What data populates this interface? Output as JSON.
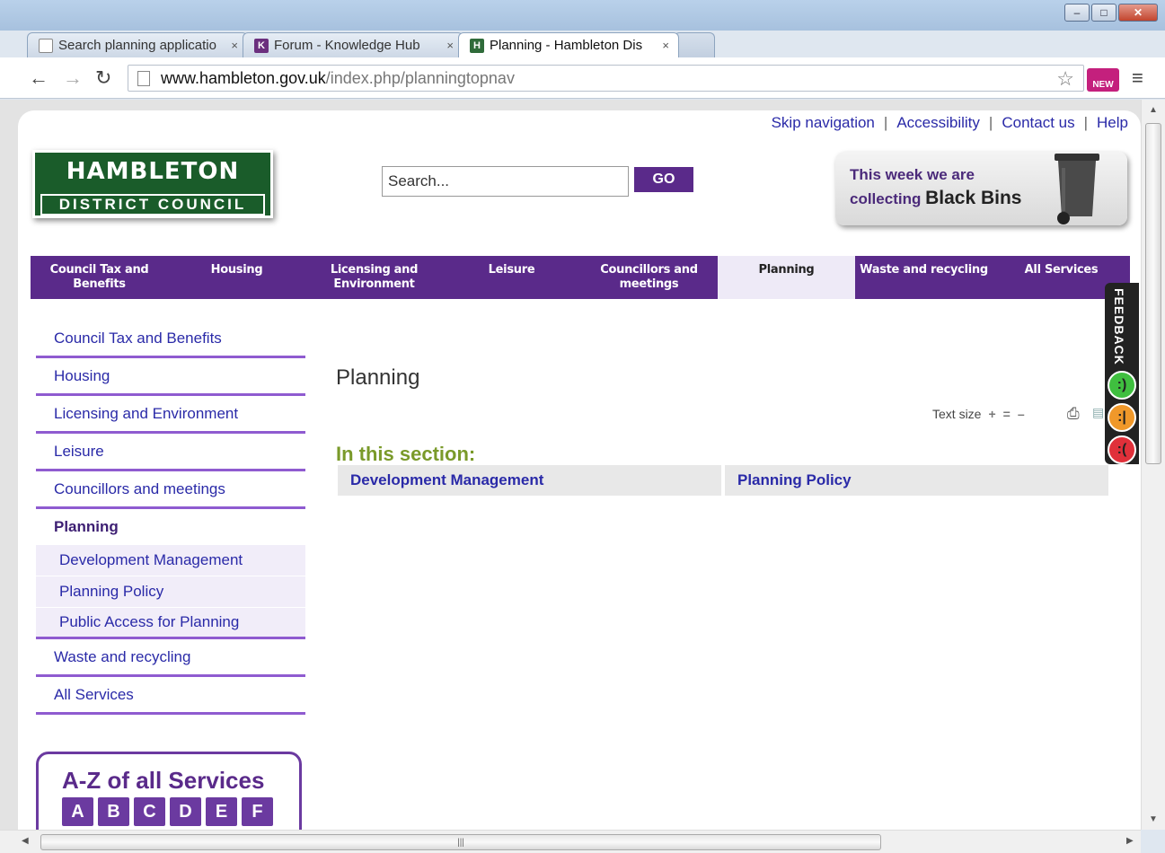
{
  "browser": {
    "tabs": [
      {
        "label": "Search planning applicatio",
        "favicon": "document-icon"
      },
      {
        "label": "Forum - Knowledge Hub",
        "favicon": "K"
      },
      {
        "label": "Planning - Hambleton Dis",
        "favicon": "H"
      }
    ],
    "tab_close": "×",
    "url_host": "www.hambleton.gov.uk",
    "url_path": "/index.php/planningtopnav",
    "extension_label": "NEW",
    "window_controls": {
      "min": "–",
      "max": "□",
      "close": "✕"
    }
  },
  "utility_nav": [
    "Skip navigation",
    "Accessibility",
    "Contact us",
    "Help"
  ],
  "utility_sep": "|",
  "logo": {
    "line1": "HAMBLETON",
    "line2": "DISTRICT COUNCIL"
  },
  "search": {
    "placeholder": "Search...",
    "button": "GO"
  },
  "promo": {
    "line1": "This week we are",
    "line2_prefix": "collecting",
    "line2_emphasis": "Black Bins"
  },
  "topnav": [
    {
      "label": "Council Tax and Benefits",
      "active": false
    },
    {
      "label": "Housing",
      "active": false
    },
    {
      "label": "Licensing and Environment",
      "active": false
    },
    {
      "label": "Leisure",
      "active": false
    },
    {
      "label": "Councillors and meetings",
      "active": false
    },
    {
      "label": "Planning",
      "active": true
    },
    {
      "label": "Waste and recycling",
      "active": false
    },
    {
      "label": "All Services",
      "active": false
    }
  ],
  "leftnav": {
    "items": [
      "Council Tax and Benefits",
      "Housing",
      "Licensing and Environment",
      "Leisure",
      "Councillors and meetings"
    ],
    "current": "Planning",
    "subitems": [
      "Development Management",
      "Planning Policy",
      "Public Access for Planning"
    ],
    "after": [
      "Waste and recycling",
      "All Services"
    ]
  },
  "az": {
    "title": "A-Z of all Services",
    "letters": [
      "A",
      "B",
      "C",
      "D",
      "E",
      "F"
    ]
  },
  "main": {
    "title": "Planning",
    "text_size_label": "Text size",
    "text_size_buttons": [
      "+",
      "=",
      "–"
    ],
    "section_title": "In this section:",
    "section_links": [
      "Development Management",
      "Planning Policy"
    ]
  },
  "feedback": {
    "label": "FEEDBACK",
    "faces": [
      {
        "glyph": ":)",
        "color": "#3fbf3f"
      },
      {
        "glyph": ":|",
        "color": "#f0982a"
      },
      {
        "glyph": ":(",
        "color": "#e0303a"
      }
    ]
  },
  "colors": {
    "brand_purple": "#5a2a8a",
    "logo_green": "#1a5c2a",
    "section_green": "#7a9a2a",
    "link_blue": "#2a2aa8"
  }
}
